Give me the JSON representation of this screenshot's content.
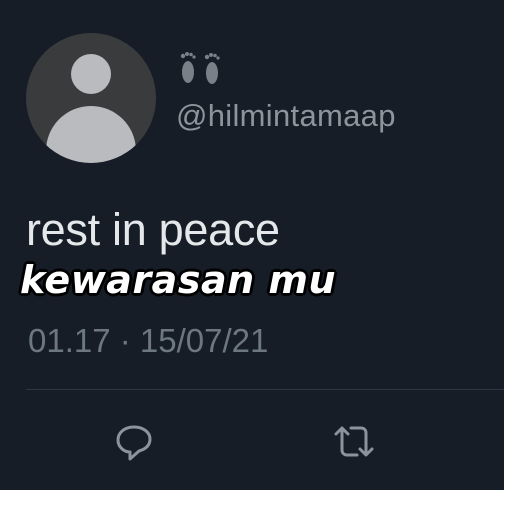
{
  "tweet": {
    "handle": "@hilmintamaap",
    "text": "rest in peace",
    "timestamp": "01.17 · 15/07/21"
  },
  "overlay": {
    "caption": "kewarasan mu"
  },
  "icons": {
    "name_emoji": "footprints-icon",
    "reply": "reply-icon",
    "retweet": "retweet-icon"
  },
  "colors": {
    "background": "#161d26",
    "text": "#e5e8ea",
    "muted": "#6d7780"
  }
}
